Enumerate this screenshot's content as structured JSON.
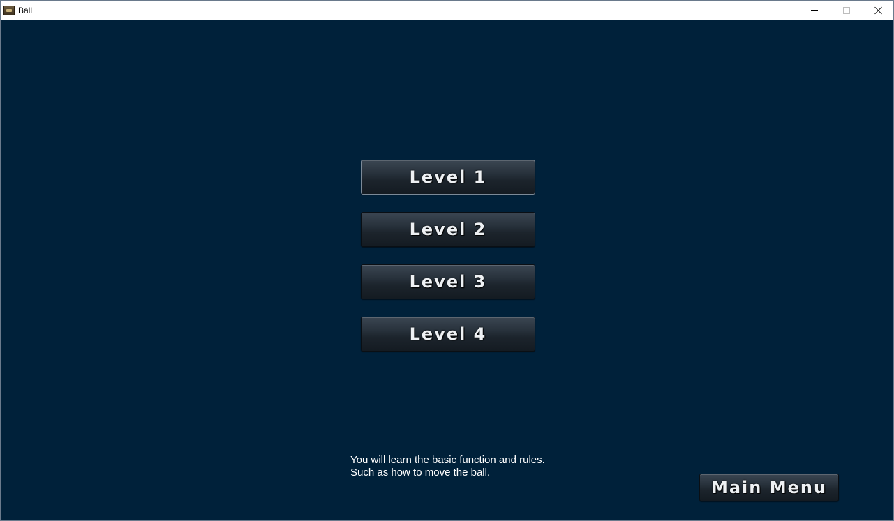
{
  "window": {
    "title": "Ball",
    "app_icon": "ball-app-icon",
    "controls": {
      "minimize": "minimize-icon",
      "maximize": "maximize-icon",
      "close": "close-icon"
    }
  },
  "levels": [
    {
      "label": "Level 1",
      "selected": true
    },
    {
      "label": "Level 2",
      "selected": false
    },
    {
      "label": "Level 3",
      "selected": false
    },
    {
      "label": "Level 4",
      "selected": false
    }
  ],
  "description": {
    "line1": "You will learn the basic function and rules.",
    "line2": "Such as how to move the ball."
  },
  "main_menu_label": "Main Menu",
  "colors": {
    "background": "#00213a",
    "button_text": "#eef1f4",
    "button_face": "#27313b"
  }
}
